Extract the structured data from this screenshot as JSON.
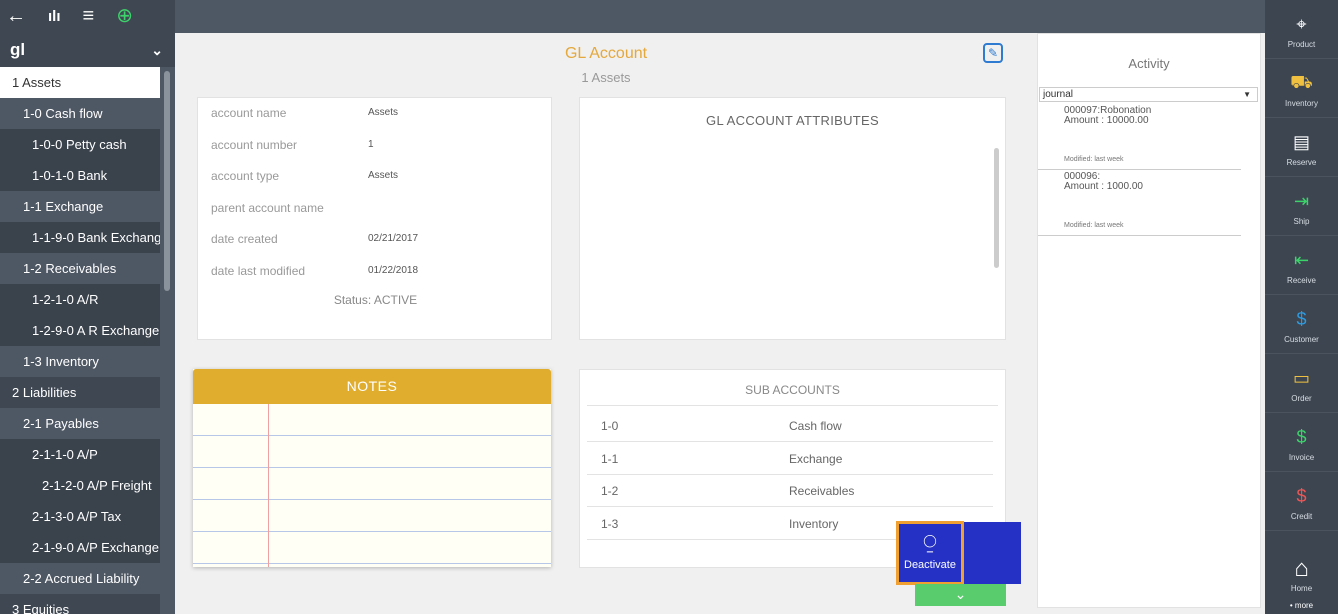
{
  "toolbar": {
    "icons": [
      "back-arrow-icon",
      "bar-chart-icon",
      "list-icon",
      "add-circle-icon"
    ],
    "back_glyph": "←",
    "chart_glyph": "ılı",
    "list_glyph": "≡",
    "add_glyph": "⊕"
  },
  "sidebar": {
    "filter": "gl",
    "chevron": "⌄",
    "items": [
      {
        "label": "1 Assets",
        "level": 0,
        "active": true
      },
      {
        "label": "1-0 Cash flow",
        "level": 1
      },
      {
        "label": "1-0-0 Petty cash",
        "level": 2
      },
      {
        "label": "1-0-1-0 Bank",
        "level": 2
      },
      {
        "label": "1-1 Exchange",
        "level": 1
      },
      {
        "label": "1-1-9-0 Bank Exchang",
        "level": 2
      },
      {
        "label": "1-2 Receivables",
        "level": 1
      },
      {
        "label": "1-2-1-0 A/R",
        "level": 2
      },
      {
        "label": "1-2-9-0 A R Exchange",
        "level": 2
      },
      {
        "label": "1-3 Inventory",
        "level": 1
      },
      {
        "label": "2 Liabilities",
        "level": 0
      },
      {
        "label": "2-1 Payables",
        "level": 1
      },
      {
        "label": "2-1-1-0 A/P",
        "level": 2
      },
      {
        "label": "2-1-2-0 A/P Freight",
        "level": 3
      },
      {
        "label": "2-1-3-0 A/P Tax",
        "level": 2
      },
      {
        "label": "2-1-9-0 A/P Exchange",
        "level": 2
      },
      {
        "label": "2-2 Accrued Liability",
        "level": 1
      },
      {
        "label": "3 Equities",
        "level": 0
      }
    ]
  },
  "header": {
    "title": "GL Account",
    "subtitle": "1 Assets",
    "edit_glyph": "✎"
  },
  "account": {
    "fields": [
      {
        "label": "account name",
        "value": "Assets"
      },
      {
        "label": "account number",
        "value": "1"
      },
      {
        "label": "account type",
        "value": "Assets"
      },
      {
        "label": "parent account name",
        "value": ""
      },
      {
        "label": "date created",
        "value": "02/21/2017"
      },
      {
        "label": "date last modified",
        "value": "01/22/2018"
      }
    ],
    "status": "Status: ACTIVE"
  },
  "attributes": {
    "title": "GL ACCOUNT ATTRIBUTES"
  },
  "notes": {
    "title": "NOTES"
  },
  "sub_accounts": {
    "title": "SUB ACCOUNTS",
    "rows": [
      {
        "code": "1-0",
        "name": "Cash flow"
      },
      {
        "code": "1-1",
        "name": "Exchange"
      },
      {
        "code": "1-2",
        "name": "Receivables"
      },
      {
        "code": "1-3",
        "name": "Inventory"
      }
    ]
  },
  "actions": {
    "deactivate_label": "Deactivate",
    "deactivate_glyph": "⍜",
    "down_glyph": "⌄"
  },
  "activity": {
    "title": "Activity",
    "filter": "journal",
    "entries": [
      {
        "line1": "000097:Robonation",
        "line2": "Amount : 10000.00",
        "modified": "Modified: last week"
      },
      {
        "line1": "000096:",
        "line2": "Amount : 1000.00",
        "modified": "Modified: last week"
      }
    ]
  },
  "rightbar": {
    "items": [
      {
        "label": "Product",
        "icon": "tag-icon",
        "glyph": "⌖",
        "color": ""
      },
      {
        "label": "Inventory",
        "icon": "hand-truck-icon",
        "glyph": "⛟",
        "color": "yellow"
      },
      {
        "label": "Reserve",
        "icon": "clipboard-icon",
        "glyph": "▤",
        "color": ""
      },
      {
        "label": "Ship",
        "icon": "truck-ship-icon",
        "glyph": "⇥",
        "color": "green"
      },
      {
        "label": "Receive",
        "icon": "truck-receive-icon",
        "glyph": "⇤",
        "color": "green"
      },
      {
        "label": "Customer",
        "icon": "customer-card-icon",
        "glyph": "$",
        "color": "blue"
      },
      {
        "label": "Order",
        "icon": "order-box-icon",
        "glyph": "▭",
        "color": "yellow"
      },
      {
        "label": "Invoice",
        "icon": "invoice-icon",
        "glyph": "$",
        "color": "green"
      },
      {
        "label": "Credit",
        "icon": "credit-icon",
        "glyph": "$",
        "color": "red"
      }
    ],
    "home_label": "Home",
    "home_glyph": "⌂",
    "more_label": "• more"
  }
}
